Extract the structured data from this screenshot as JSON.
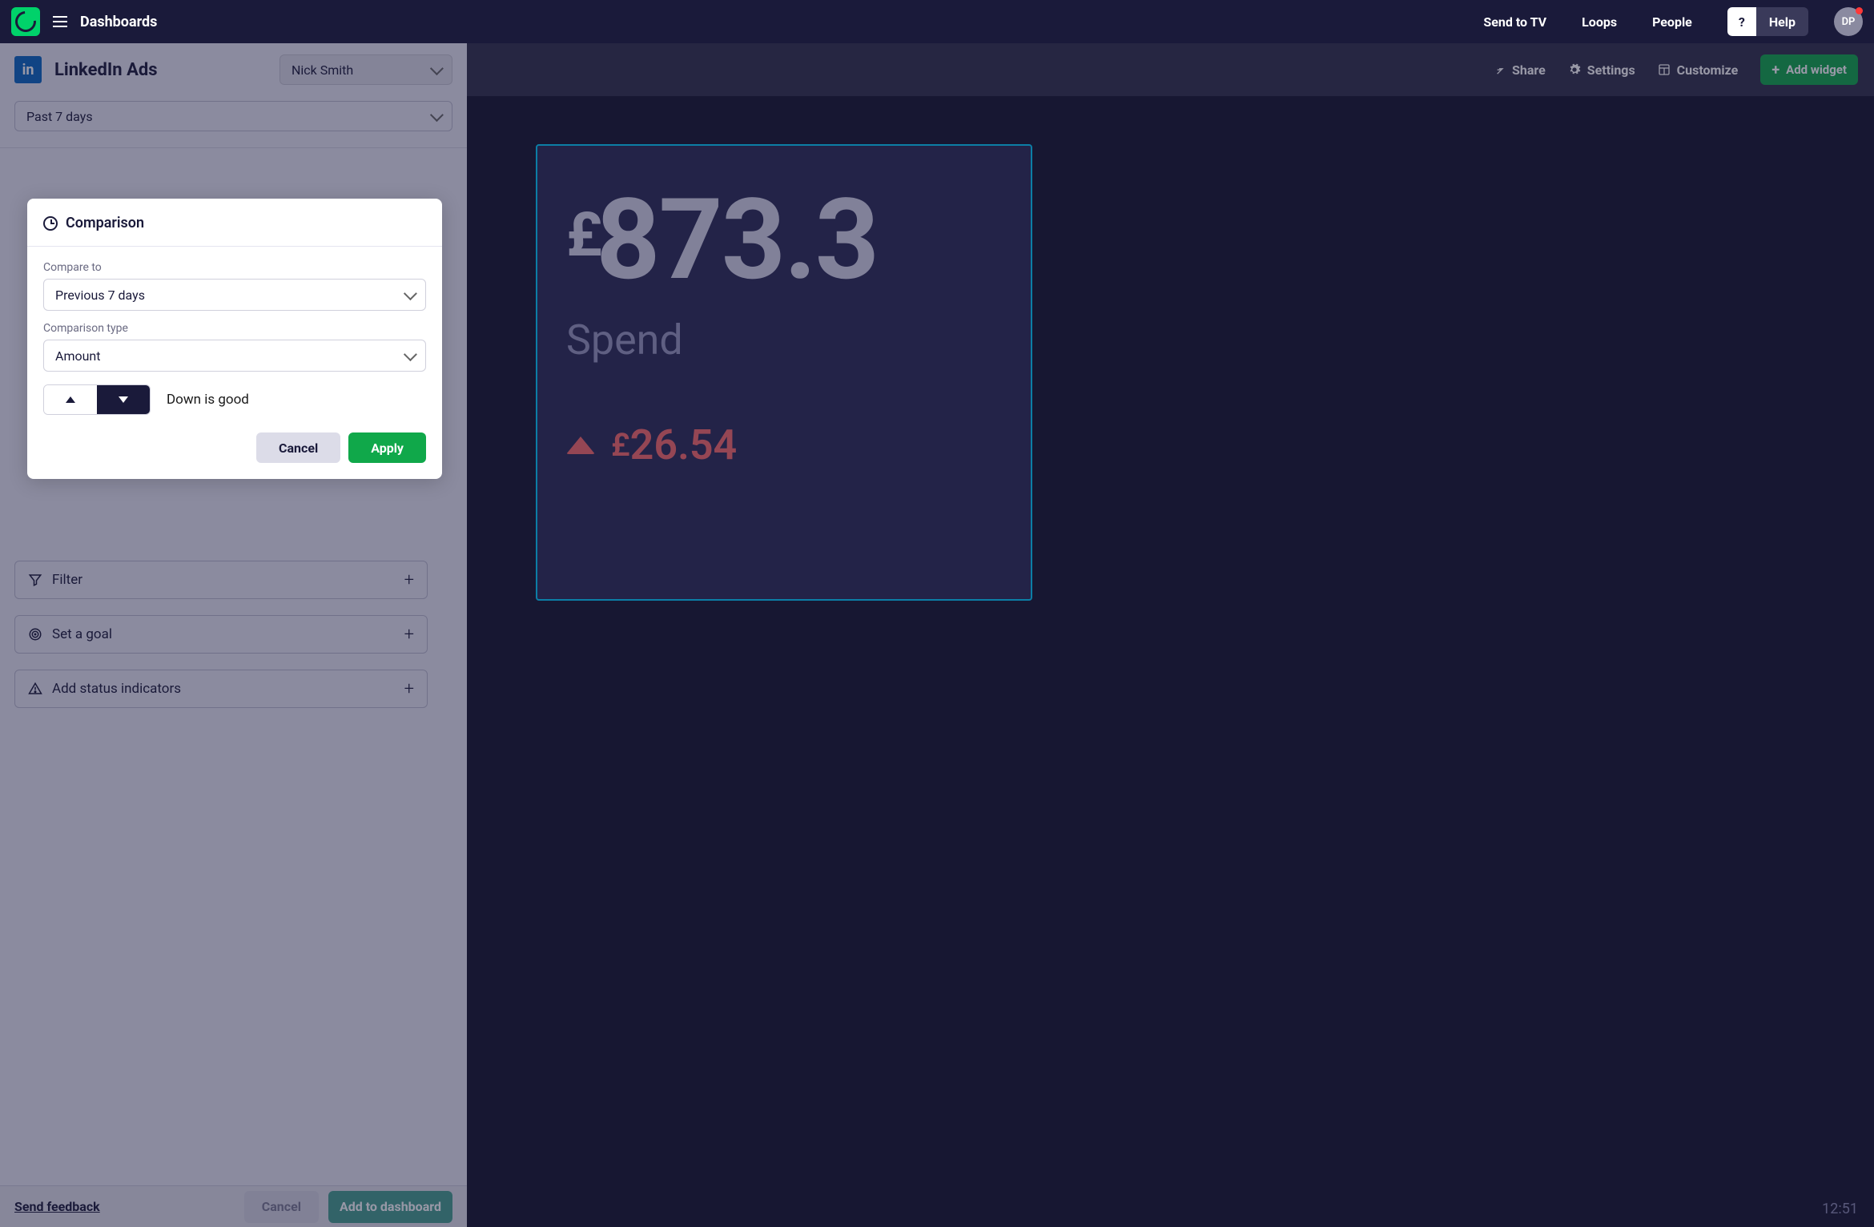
{
  "nav": {
    "title": "Dashboards",
    "links": {
      "sendtv": "Send to TV",
      "loops": "Loops",
      "people": "People"
    },
    "help_q": "?",
    "help": "Help",
    "avatar": "DP"
  },
  "panel": {
    "source_label": "in",
    "title": "LinkedIn Ads",
    "account": "Nick Smith",
    "timeframe": "Past 7 days",
    "filter": "Filter",
    "goal": "Set a goal",
    "status": "Add status indicators"
  },
  "comparison": {
    "title": "Comparison",
    "compare_to_label": "Compare to",
    "compare_to_value": "Previous 7 days",
    "type_label": "Comparison type",
    "type_value": "Amount",
    "direction_label": "Down is good",
    "cancel": "Cancel",
    "apply": "Apply"
  },
  "bottom": {
    "feedback": "Send feedback",
    "cancel": "Cancel",
    "add": "Add to dashboard"
  },
  "toolbar": {
    "share": "Share",
    "settings": "Settings",
    "customize": "Customize",
    "add_widget": "Add widget"
  },
  "widget": {
    "currency": "£",
    "value": "873.3",
    "label": "Spend",
    "delta_currency": "£",
    "delta": "26.54"
  },
  "clock": "12:51"
}
